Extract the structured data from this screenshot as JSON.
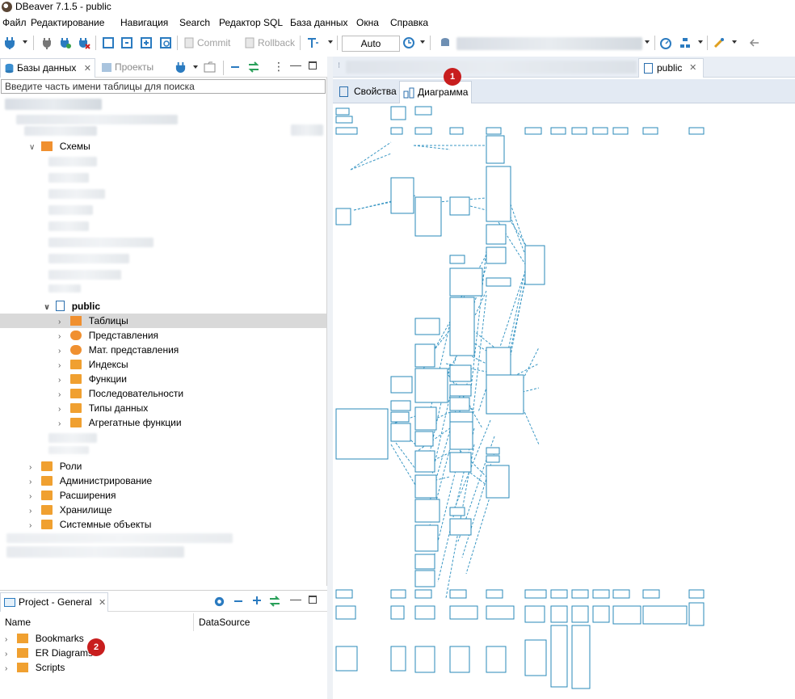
{
  "window": {
    "title": "DBeaver 7.1.5 - public"
  },
  "menu": [
    "Файл",
    "Редактирование",
    "Навигация",
    "Search",
    "Редактор SQL",
    "База данных",
    "Окна",
    "Справка"
  ],
  "toolbar": {
    "commit_label": "Commit",
    "rollback_label": "Rollback",
    "transaction_mode": "Auto"
  },
  "left_tabs": {
    "databases": "Базы данных",
    "projects": "Проекты"
  },
  "search": {
    "placeholder": "Введите часть имени таблицы для поиска"
  },
  "tree": {
    "schemas": "Схемы",
    "public": "public",
    "items": [
      "Таблицы",
      "Представления",
      "Мат. представления",
      "Индексы",
      "Функции",
      "Последовательности",
      "Типы данных",
      "Агрегатные функции"
    ],
    "bottom_items": [
      "Роли",
      "Администрирование",
      "Расширения",
      "Хранилище",
      "Системные объекты"
    ]
  },
  "project": {
    "title": "Project - General",
    "columns": [
      "Name",
      "DataSource"
    ],
    "items": [
      "Bookmarks",
      "ER Diagrams",
      "Scripts"
    ]
  },
  "editor": {
    "tab_label": "public",
    "subtabs": [
      "Свойства",
      "Диаграмма"
    ]
  },
  "badges": [
    "1",
    "2"
  ],
  "colors": {
    "diagram_line": "#3a97c4",
    "badge": "#c81e1e",
    "folder": "#f0a030",
    "selection": "#d9d9d9"
  }
}
